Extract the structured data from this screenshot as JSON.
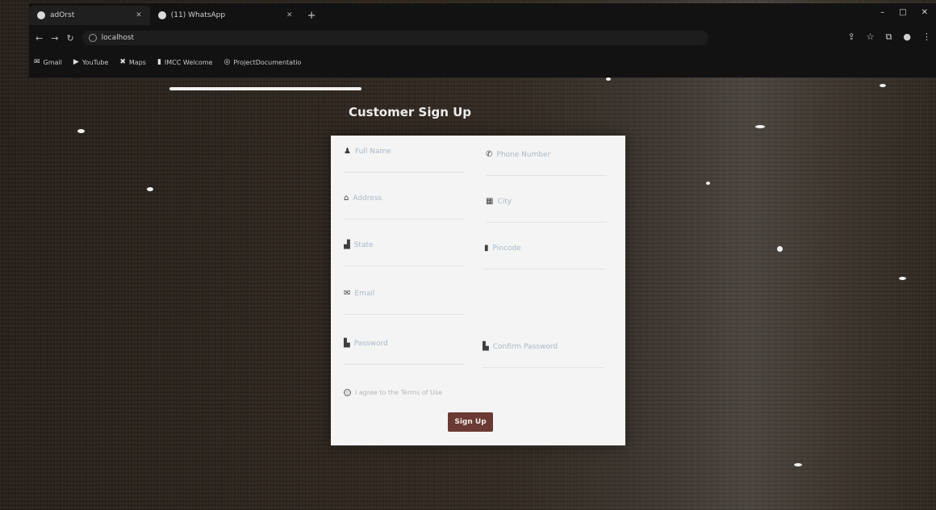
{
  "browser": {
    "tabs": [
      {
        "label": "adOrst",
        "active": true
      },
      {
        "label": "(11) WhatsApp",
        "active": false
      }
    ],
    "new_tab": "+",
    "address": "localhost",
    "window_controls": [
      "–",
      "□",
      "✕"
    ],
    "bookmarks": [
      {
        "label": "Gmail",
        "icon": "mail-icon"
      },
      {
        "label": "YouTube",
        "icon": "play-icon"
      },
      {
        "label": "Maps",
        "icon": "map-icon"
      },
      {
        "label": "IMCC Welcome",
        "icon": "bookmark-icon"
      },
      {
        "label": "ProjectDocumentatio",
        "icon": "globe-icon"
      }
    ]
  },
  "page": {
    "title": "Customer Sign Up",
    "form": {
      "fields": [
        {
          "label": "Full Name",
          "icon": "user-icon"
        },
        {
          "label": "Phone Number",
          "icon": "phone-icon"
        },
        {
          "label": "Address",
          "icon": "home-icon"
        },
        {
          "label": "City",
          "icon": "building-icon"
        },
        {
          "label": "State",
          "icon": "bank-icon"
        },
        {
          "label": "Pincode",
          "icon": "pin-icon"
        },
        {
          "label": "Email",
          "icon": "envelope-icon"
        },
        {
          "label": "Password",
          "icon": "lock-icon"
        },
        {
          "label": "Confirm Password",
          "icon": "lock-icon"
        }
      ],
      "terms_label": "I agree to the Terms of Use",
      "submit_label": "Sign Up"
    }
  },
  "colors": {
    "card": "#f4f4f4",
    "submit": "#6b3a34",
    "chrome": "#121212"
  }
}
